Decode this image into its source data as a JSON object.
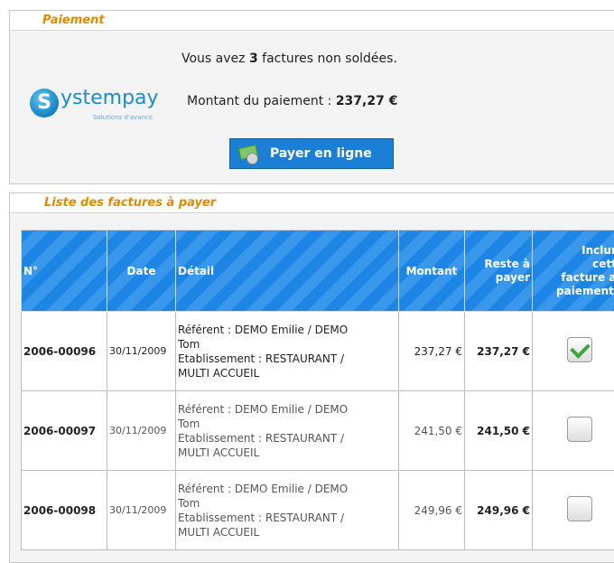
{
  "payment": {
    "header": "Paiement",
    "open_invoices_pre": "Vous avez ",
    "open_invoices_count": "3",
    "open_invoices_post": " factures non soldées.",
    "amount_label": "Montant du paiement : ",
    "amount_value": "237,27 €",
    "logo": {
      "letter": "S",
      "name": "ystempay",
      "tagline": "Solutions d'avance"
    },
    "pay_button_label": "Payer en ligne",
    "pay_button_icon": "money-icon"
  },
  "invoices": {
    "header": "Liste des factures à payer",
    "columns": {
      "num": "N°",
      "date": "Date",
      "detail": "Détail",
      "amount": "Montant",
      "remaining_1": "Reste à",
      "remaining_2": "payer",
      "include_1": "Inclure",
      "include_2": "cette",
      "include_3": "facture au",
      "include_4": "paiement ?"
    },
    "rows": [
      {
        "num": "2006-00096",
        "date": "30/11/2009",
        "detail_1": "Référent : DEMO Emilie / DEMO",
        "detail_2": "Tom",
        "detail_3": "Etablissement : RESTAURANT /",
        "detail_4": "MULTI ACCUEIL",
        "amount": "237,27 €",
        "remaining": "237,27 €",
        "included": true
      },
      {
        "num": "2006-00097",
        "date": "30/11/2009",
        "detail_1": "Référent : DEMO Emilie / DEMO",
        "detail_2": "Tom",
        "detail_3": "Etablissement : RESTAURANT /",
        "detail_4": "MULTI ACCUEIL",
        "amount": "241,50 €",
        "remaining": "241,50 €",
        "included": false
      },
      {
        "num": "2006-00098",
        "date": "30/11/2009",
        "detail_1": "Référent : DEMO Emilie / DEMO",
        "detail_2": "Tom",
        "detail_3": "Etablissement : RESTAURANT /",
        "detail_4": "MULTI ACCUEIL",
        "amount": "249,96 €",
        "remaining": "249,96 €",
        "included": false
      }
    ]
  },
  "colors": {
    "section_title": "#e08a00",
    "header_blue": "#1d86e4",
    "button_blue": "#1b7fd6",
    "check_green": "#3aa83a"
  }
}
